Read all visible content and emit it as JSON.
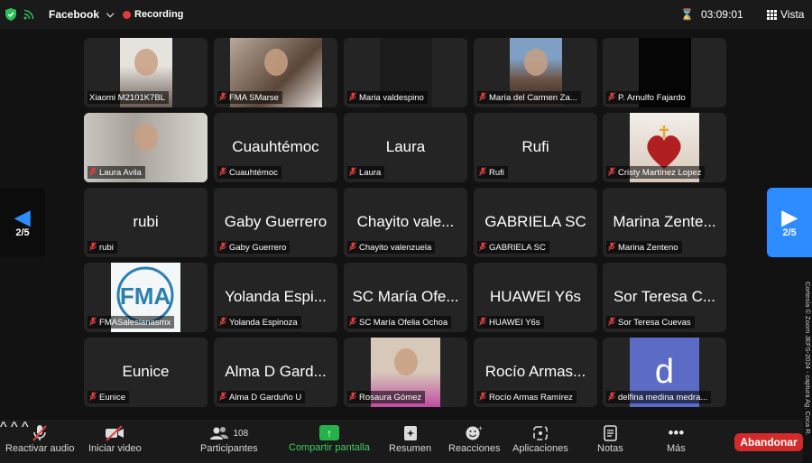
{
  "topbar": {
    "app_label": "Facebook",
    "recording_label": "Recording",
    "timer": "03:09:01",
    "view_label": "Vista"
  },
  "pager": {
    "left_label": "2/5",
    "right_label": "2/5"
  },
  "tiles": [
    {
      "label": "Xiaomi M2101K7BL",
      "big": "",
      "muted": false,
      "video": "photo"
    },
    {
      "label": "FMA SMarse",
      "big": "",
      "muted": true,
      "video": "photo"
    },
    {
      "label": "Maria valdespino",
      "big": "",
      "muted": true,
      "video": "dark"
    },
    {
      "label": "María del Carmen Za...",
      "big": "",
      "muted": true,
      "video": "photo"
    },
    {
      "label": "P. Arnulfo Fajardo",
      "big": "",
      "muted": true,
      "video": "black"
    },
    {
      "label": "Laura Avila",
      "big": "",
      "muted": true,
      "video": "photo"
    },
    {
      "label": "Cuauhtémoc",
      "big": "Cuauhtémoc",
      "muted": true
    },
    {
      "label": "Laura",
      "big": "Laura",
      "muted": true
    },
    {
      "label": "Rufi",
      "big": "Rufi",
      "muted": true
    },
    {
      "label": "Cristy Martínez Lopez",
      "big": "",
      "muted": true,
      "video": "heart"
    },
    {
      "label": "rubi",
      "big": "rubi",
      "muted": true
    },
    {
      "label": "Gaby Guerrero",
      "big": "Gaby Guerrero",
      "muted": true
    },
    {
      "label": "Chayito valenzuela",
      "big": "Chayito vale...",
      "muted": true
    },
    {
      "label": "GABRIELA SC",
      "big": "GABRIELA SC",
      "muted": true
    },
    {
      "label": "Marina Zenteno",
      "big": "Marina Zente...",
      "muted": true
    },
    {
      "label": "FMASalesianasmx",
      "big": "",
      "muted": true,
      "video": "logo"
    },
    {
      "label": "Yolanda Espinoza",
      "big": "Yolanda Espi...",
      "muted": true
    },
    {
      "label": "SC María Ofelia Ochoa",
      "big": "SC María Ofe...",
      "muted": true
    },
    {
      "label": "HUAWEI Y6s",
      "big": "HUAWEI Y6s",
      "muted": true
    },
    {
      "label": "Sor Teresa Cuevas",
      "big": "Sor Teresa C...",
      "muted": true
    },
    {
      "label": "Eunice",
      "big": "Eunice",
      "muted": true
    },
    {
      "label": "Alma D Garduño U",
      "big": "Alma D Gard...",
      "muted": true
    },
    {
      "label": "Rosaura Gómez",
      "big": "",
      "muted": true,
      "video": "photo"
    },
    {
      "label": "Rocío Armas Ramírez",
      "big": "Rocío Armas...",
      "muted": true
    },
    {
      "label": "delfina medina medra...",
      "big": "",
      "muted": true,
      "video": "avatar",
      "avatar_letter": "d"
    }
  ],
  "toolbar": {
    "unmute": "Reactivar audio",
    "start_video": "Iniciar video",
    "participants": "Participantes",
    "participants_count": "108",
    "share": "Compartir pantalla",
    "summary": "Resumen",
    "reactions": "Reacciones",
    "apps": "Aplicaciones",
    "notes": "Notas",
    "more": "Más",
    "leave": "Abandonar"
  },
  "credit": "Cortesía © Zoom JEFS-2024 - captura Ag. Coca R.",
  "colors": {
    "accent": "#2d8cff",
    "muted_icon": "#e04040",
    "leave": "#d32a2a",
    "share": "#26b24a"
  }
}
